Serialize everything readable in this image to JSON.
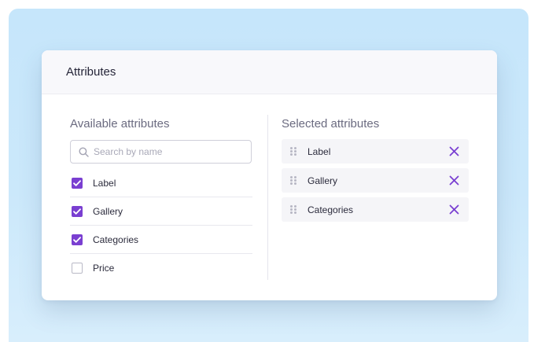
{
  "panel": {
    "title": "Attributes"
  },
  "available": {
    "title": "Available attributes",
    "search": {
      "placeholder": "Search by name",
      "value": ""
    },
    "items": [
      {
        "label": "Label",
        "checked": true
      },
      {
        "label": "Gallery",
        "checked": true
      },
      {
        "label": "Categories",
        "checked": true
      },
      {
        "label": "Price",
        "checked": false
      }
    ]
  },
  "selected": {
    "title": "Selected attributes",
    "items": [
      {
        "label": "Label"
      },
      {
        "label": "Gallery"
      },
      {
        "label": "Categories"
      }
    ]
  },
  "icons": {
    "search": "search-icon",
    "check": "check-icon",
    "drag": "drag-handle-icon",
    "remove": "close-icon"
  },
  "colors": {
    "accent": "#7a3fd1",
    "backdrop": "#c6e6fb"
  }
}
